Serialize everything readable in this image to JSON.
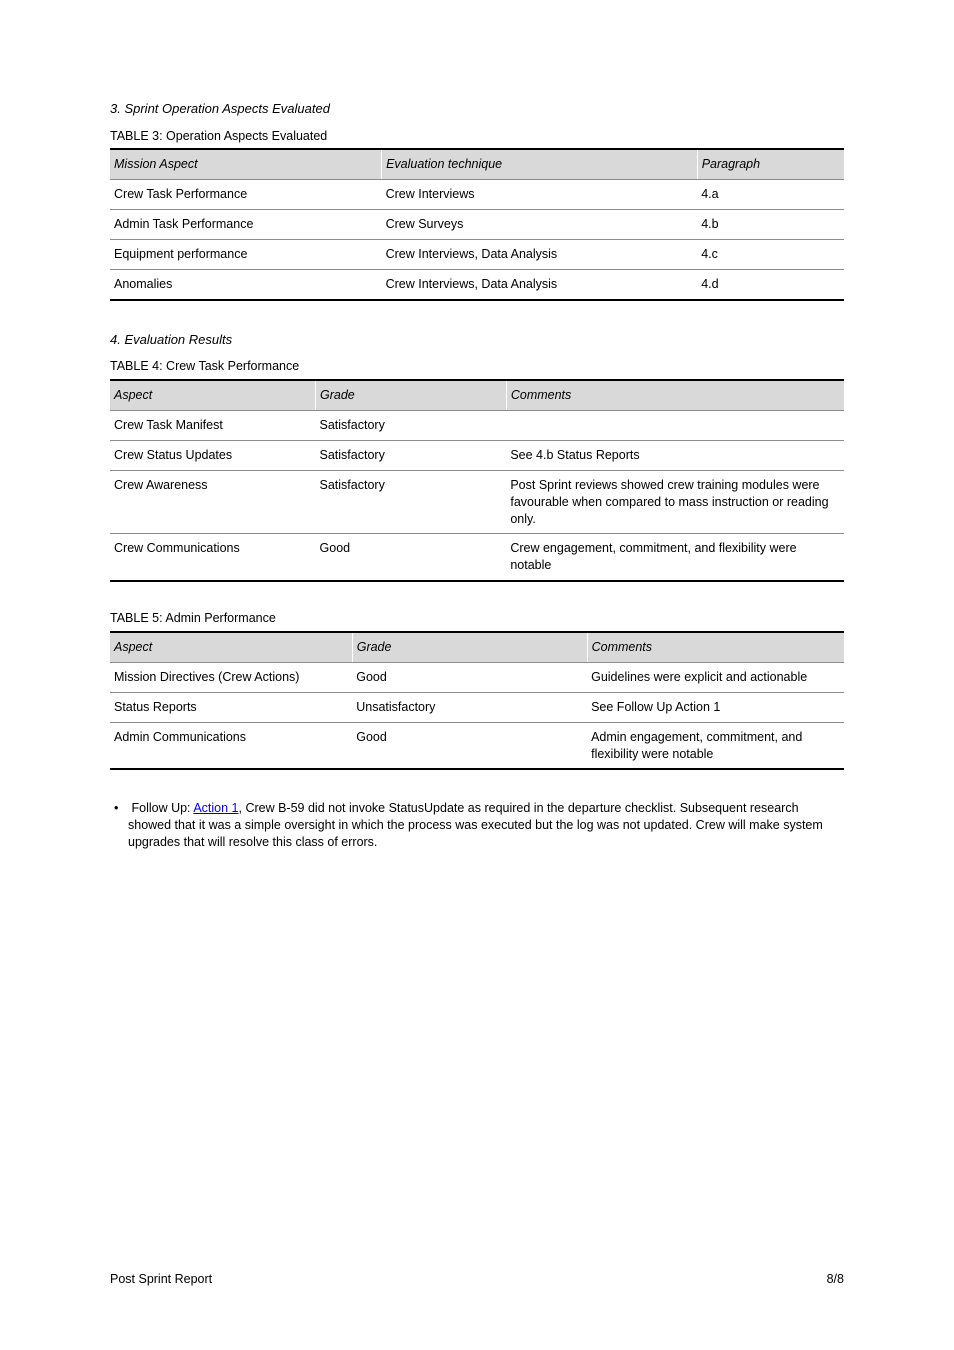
{
  "section3": {
    "heading": "3. Sprint Operation Aspects Evaluated",
    "caption": "TABLE 3: Operation Aspects Evaluated",
    "headers": [
      "Mission Aspect",
      "Evaluation technique",
      "Paragraph"
    ],
    "rows": [
      [
        "Crew Task Performance",
        "Crew Interviews",
        "4.a"
      ],
      [
        "Admin Task Performance",
        "Crew Surveys",
        "4.b"
      ],
      [
        "Equipment performance",
        "Crew Interviews, Data Analysis",
        "4.c"
      ],
      [
        "Anomalies",
        "Crew Interviews, Data Analysis",
        "4.d"
      ]
    ]
  },
  "section4": {
    "heading": "4. Evaluation Results",
    "subA": {
      "caption": "TABLE 4: Crew Task Performance",
      "headers": [
        "Aspect",
        "Grade",
        "Comments"
      ],
      "rows": [
        [
          "Crew Task Manifest",
          "Satisfactory",
          ""
        ],
        [
          "Crew Status Updates",
          "Satisfactory",
          "See 4.b Status Reports"
        ],
        [
          "Crew Awareness",
          "Satisfactory",
          "Post Sprint reviews showed crew training modules were favourable when compared to mass instruction or reading only."
        ],
        [
          "Crew Communications",
          "Good",
          "Crew engagement, commitment, and flexibility were notable"
        ]
      ]
    },
    "subB": {
      "caption": "TABLE 5: Admin Performance",
      "headers": [
        "Aspect",
        "Grade",
        "Comments"
      ],
      "rows": [
        [
          "Mission Directives (Crew Actions)",
          "Good",
          "Guidelines were explicit and actionable"
        ],
        [
          "Status Reports",
          "Unsatisfactory",
          "See Follow Up Action 1"
        ],
        [
          "Admin Communications",
          "Good",
          "Admin engagement, commitment, and flexibility were notable"
        ]
      ]
    }
  },
  "followup": {
    "prefix": "Follow Up: ",
    "linkText": "Action 1",
    "rest": ", Crew B-59 did not invoke StatusUpdate as required in the departure checklist. Subsequent research showed that it was a simple oversight in which the process was executed but the log was not updated. Crew will make system upgrades that will resolve this class of errors."
  },
  "footer": {
    "left": "Post Sprint Report",
    "right": "8/8"
  }
}
